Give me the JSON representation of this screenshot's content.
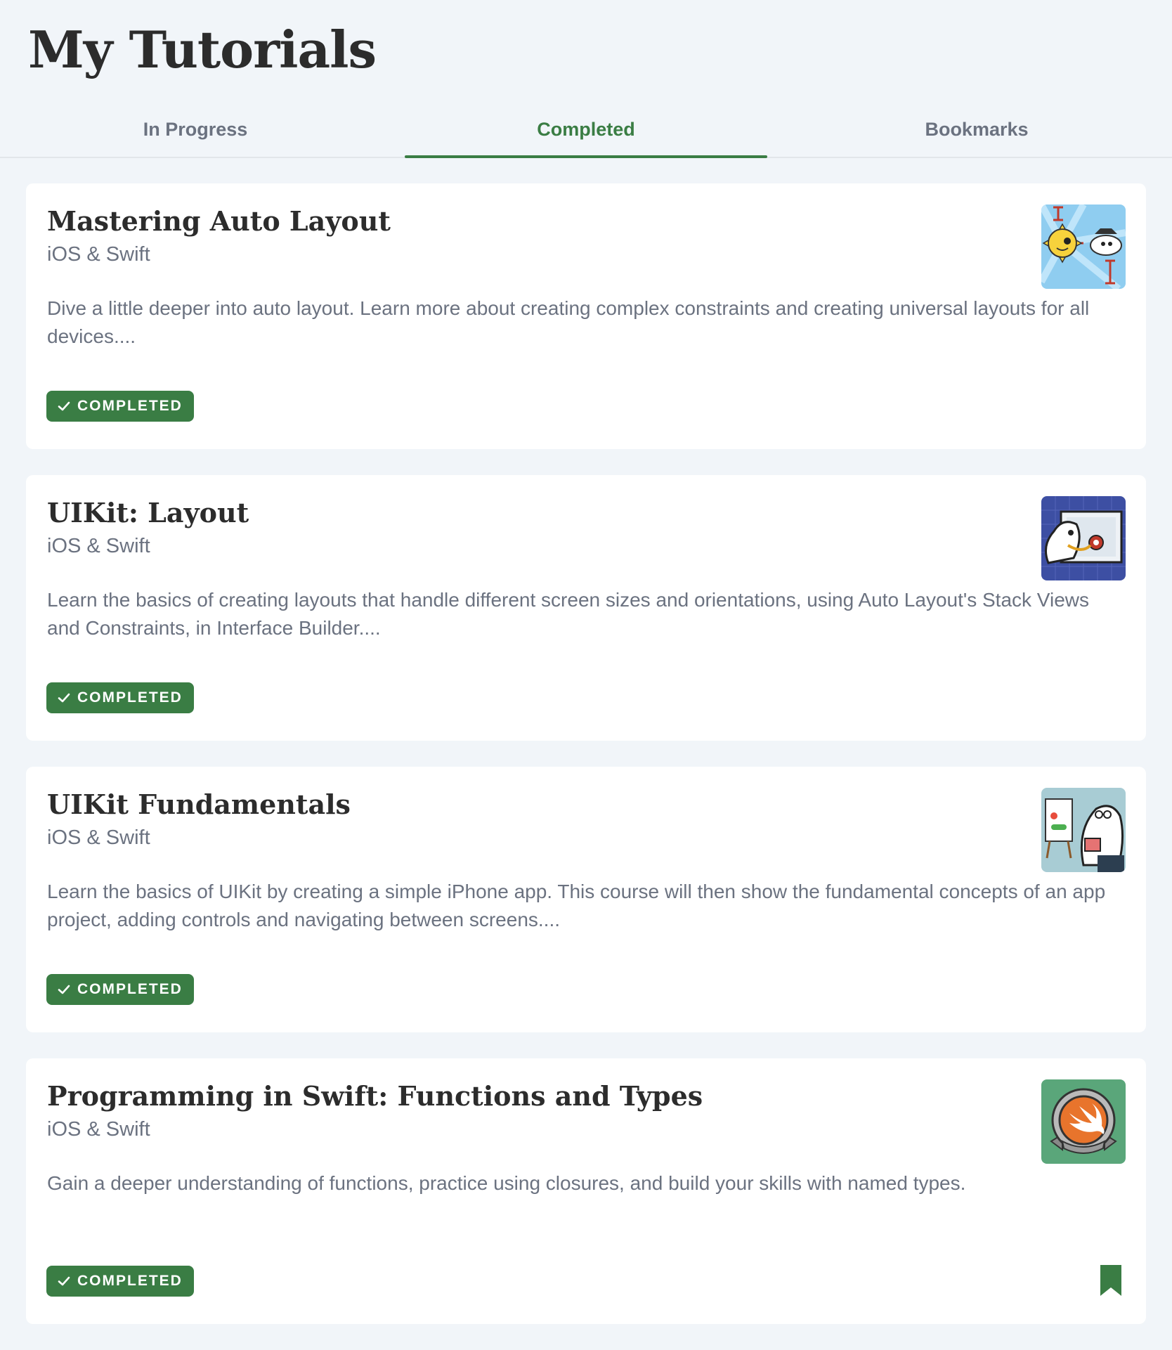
{
  "page": {
    "title": "My Tutorials"
  },
  "tabs": [
    {
      "label": "In Progress"
    },
    {
      "label": "Completed"
    },
    {
      "label": "Bookmarks"
    }
  ],
  "active_tab": "Completed",
  "colors": {
    "accent": "#3a7d44",
    "background": "#f1f5f9",
    "card": "#ffffff",
    "muted_text": "#6b7280"
  },
  "tutorials": [
    {
      "title": "Mastering Auto Layout",
      "domain": "iOS & Swift",
      "description": "Dive a little deeper into auto layout. Learn more about creating complex constraints and creating universal layouts for all devices....",
      "status": "COMPLETED",
      "thumbnail_icon": "auto-layout-artwork-icon"
    },
    {
      "title": "UIKit: Layout",
      "domain": "iOS & Swift",
      "description": "Learn the basics of creating layouts that handle different screen sizes and orientations, using Auto Layout's Stack Views and Constraints, in Interface Builder....",
      "status": "COMPLETED",
      "thumbnail_icon": "uikit-layout-artwork-icon"
    },
    {
      "title": "UIKit Fundamentals",
      "domain": "iOS & Swift",
      "description": "Learn the basics of UIKit by creating a simple iPhone app. This course will then show the fundamental concepts of an app project, adding controls and navigating between screens....",
      "status": "COMPLETED",
      "thumbnail_icon": "uikit-fundamentals-artwork-icon"
    },
    {
      "title": "Programming in Swift: Functions and Types",
      "domain": "iOS & Swift",
      "description": "Gain a deeper understanding of functions, practice using closures, and build your skills with named types.",
      "status": "COMPLETED",
      "thumbnail_icon": "swift-badge-artwork-icon",
      "bookmarked": true
    }
  ]
}
